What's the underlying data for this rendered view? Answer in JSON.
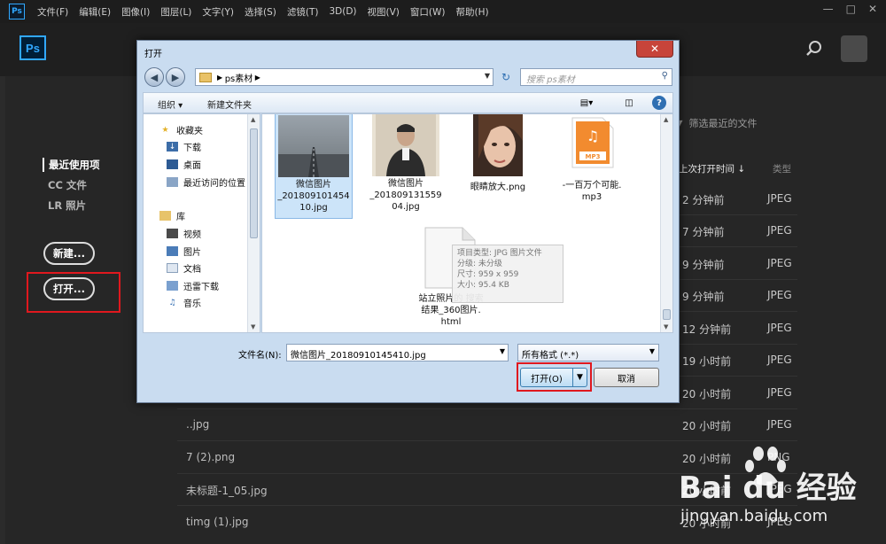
{
  "menubar": {
    "app_badge": "Ps",
    "items": [
      "文件(F)",
      "编辑(E)",
      "图像(I)",
      "图层(L)",
      "文字(Y)",
      "选择(S)",
      "滤镜(T)",
      "3D(D)",
      "视图(V)",
      "窗口(W)",
      "帮助(H)"
    ]
  },
  "home": {
    "logo": "Ps",
    "nav": [
      "最近使用项",
      "CC 文件",
      "LR 照片"
    ],
    "new_button": "新建...",
    "open_button": "打开...",
    "filter_placeholder": "筛选最近的文件",
    "col_time": "上次打开时间 ↓",
    "col_type": "类型",
    "recent_files": [
      {
        "name": "",
        "time": "2 分钟前",
        "type": "JPEG"
      },
      {
        "name": "",
        "time": "7 分钟前",
        "type": "JPEG"
      },
      {
        "name": "",
        "time": "9 分钟前",
        "type": "JPEG"
      },
      {
        "name": "",
        "time": "9 分钟前",
        "type": "JPEG"
      },
      {
        "name": "",
        "time": "12 分钟前",
        "type": "JPEG"
      },
      {
        "name": "",
        "time": "19 小时前",
        "type": "JPEG"
      },
      {
        "name": "",
        "time": "20 小时前",
        "type": "JPEG"
      },
      {
        "name": "",
        "time": "20 小时前",
        "type": "JPEG"
      },
      {
        "name": "..jpg",
        "time": "20 小时前",
        "type": "JPEG"
      },
      {
        "name": "7 (2).png",
        "time": "20 小时前",
        "type": "PNG"
      },
      {
        "name": "未标题-1_05.jpg",
        "time": "20 小时前",
        "type": "JPEG"
      },
      {
        "name": "timg (1).jpg",
        "time": "20 小时前",
        "type": "JPEG"
      }
    ]
  },
  "dialog": {
    "title": "打开",
    "close": "✕",
    "breadcrumb": [
      "ps素材"
    ],
    "search_placeholder": "搜索 ps素材",
    "toolbar": {
      "organize": "组织 ▾",
      "new_folder": "新建文件夹"
    },
    "nav_tree": {
      "favorites_header": "收藏夹",
      "favorites": [
        "下载",
        "桌面",
        "最近访问的位置"
      ],
      "libraries_header": "库",
      "libraries": [
        "视频",
        "图片",
        "文档",
        "迅雷下载",
        "音乐"
      ]
    },
    "files": [
      {
        "name": "微信图片_2018091014541 0.jpg",
        "line1": "微信图片",
        "line2": "_201809101454",
        "line3": "10.jpg",
        "selected": true
      },
      {
        "name": "微信图片_2018091315590 4.jpg",
        "line1": "微信图片",
        "line2": "_201809131559",
        "line3": "04.jpg",
        "selected": false
      },
      {
        "name": "眼睛放大.png",
        "line1": "眼睛放大.png",
        "line2": "",
        "line3": "",
        "selected": false
      },
      {
        "name": "-一百万个可能.mp3",
        "line1": "-一百万个可能.",
        "line2": "mp3",
        "line3": "",
        "selected": false
      },
      {
        "name": "站立照片的 搜索结果_360图片.html",
        "line1": "站立照片的 搜索",
        "line2": "结果_360图片.",
        "line3": "html",
        "selected": false
      }
    ],
    "tooltip": [
      "项目类型: JPG 图片文件",
      "分级: 未分级",
      "尺寸: 959 x 959",
      "大小: 95.4 KB"
    ],
    "mp3_badge": "MP3",
    "filename_label": "文件名(N):",
    "filename_value": "微信图片_20180910145410.jpg",
    "format_value": "所有格式 (*.*)",
    "open_label": "打开(O)",
    "cancel_label": "取消"
  },
  "watermark": {
    "brand": "Bai du 经验",
    "url": "jingyan.baidu.com"
  }
}
